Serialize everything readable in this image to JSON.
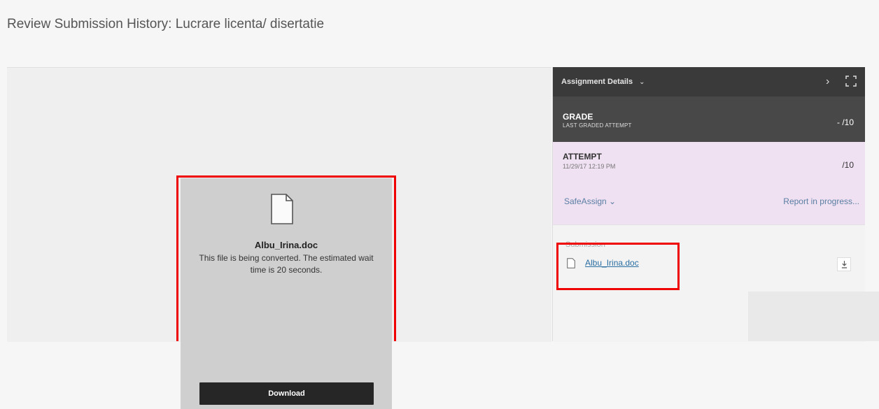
{
  "page": {
    "title": "Review Submission History: Lucrare licenta/ disertatie"
  },
  "preview": {
    "filename": "Albu_Irina.doc",
    "message": "This file is being converted. The estimated wait time is 20 seconds.",
    "download_label": "Download",
    "icon": "document-icon"
  },
  "panel": {
    "header_title": "Assignment Details",
    "header_chevron": "⌄",
    "collapse_icon": "chevron-right-icon",
    "expand_icon": "fullscreen-icon",
    "grade": {
      "title": "GRADE",
      "subtitle": "LAST GRADED ATTEMPT",
      "value": "- /10"
    },
    "attempt": {
      "title": "ATTEMPT",
      "date": "11/29/17 12:19 PM",
      "score": "/10",
      "safeassign_label": "SafeAssign",
      "safeassign_chevron": "⌄",
      "report_status": "Report in progress..."
    },
    "submission": {
      "label": "Submission",
      "filename": "Albu_Irina.doc",
      "download_icon": "download-icon"
    }
  },
  "colors": {
    "highlight": "#e00000",
    "header_bg": "#3a3a3a",
    "grade_bg": "#484848",
    "attempt_bg": "#efe0f2",
    "link": "#2a6da1"
  }
}
